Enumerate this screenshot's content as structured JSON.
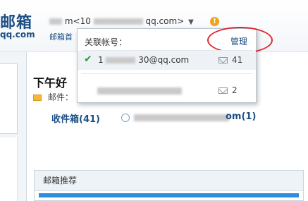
{
  "header": {
    "logo_main": "邮箱",
    "logo_sub": "qq.com",
    "account_prefix": "m<10",
    "account_suffix": "qq.com>",
    "caret": "▼",
    "home_link": "邮箱首"
  },
  "dropdown": {
    "title": "关联帐号：",
    "manage_label": "管理",
    "accounts": [
      {
        "email_prefix": "1",
        "email_suffix": "30@qq.com",
        "unread": "41"
      },
      {
        "unread": "2"
      }
    ]
  },
  "main": {
    "greeting": "下午好",
    "mail_label": "邮件：",
    "inbox_label": "收件箱(41)",
    "inbox_tail": "om(1)",
    "recommend_title": "邮箱推荐"
  },
  "colors": {
    "accent": "#1c4f86",
    "highlight_ring": "#e0292e",
    "check": "#2fa02f",
    "bar": "#2d8ee0"
  },
  "icons": [
    "check-icon",
    "mail-icon",
    "warning-icon",
    "envelope-icon",
    "person-icon"
  ]
}
